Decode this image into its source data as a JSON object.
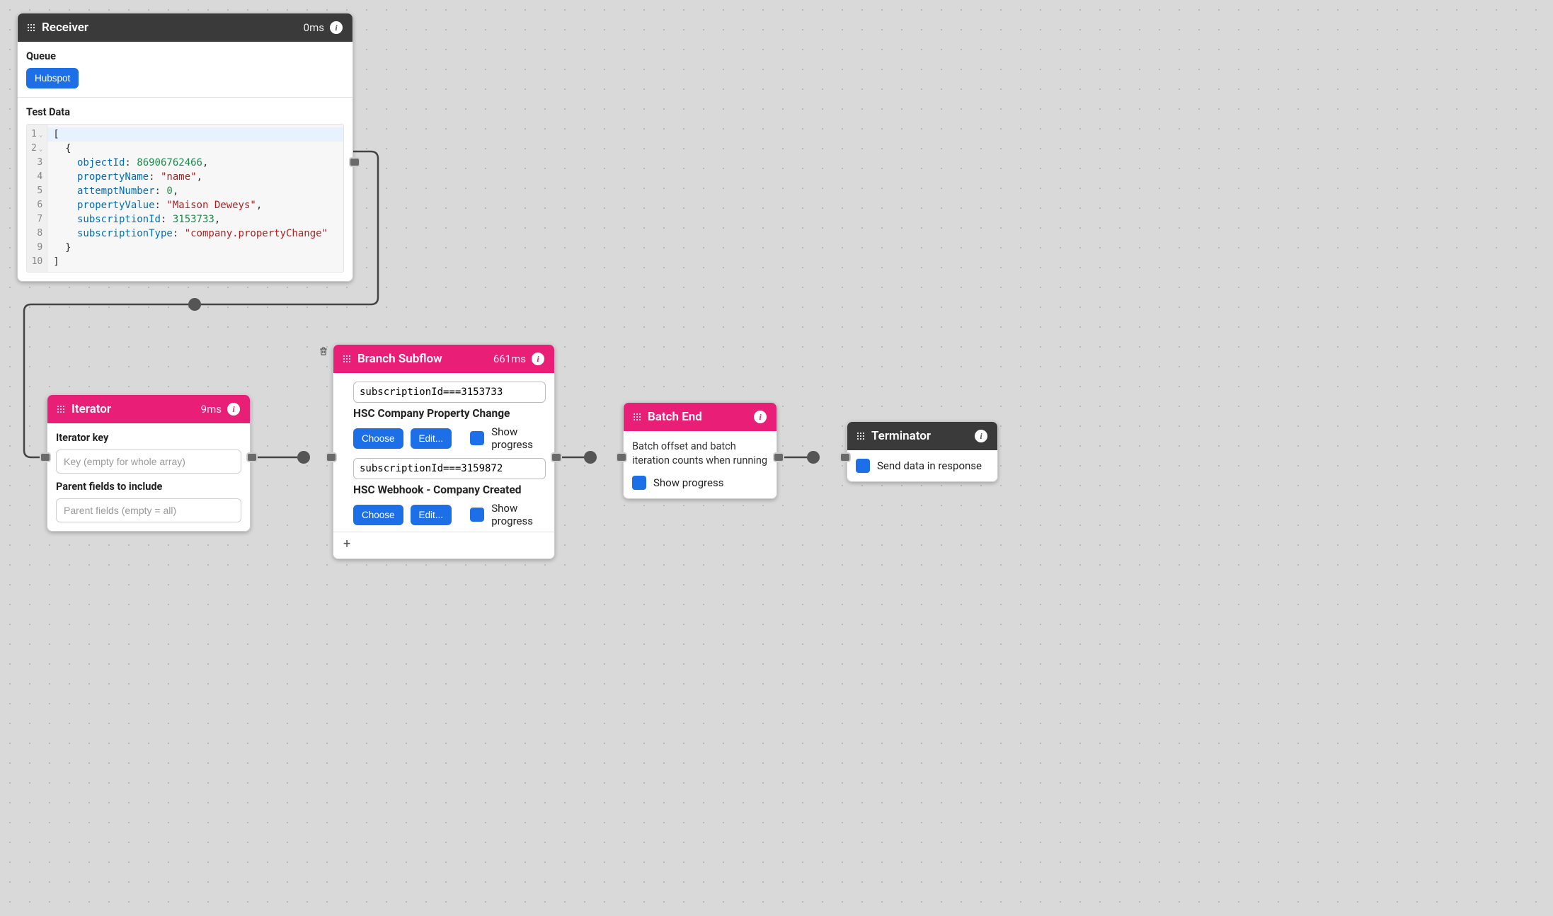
{
  "receiver": {
    "title": "Receiver",
    "time": "0ms",
    "queue_label": "Queue",
    "queue_pill": "Hubspot",
    "testdata_label": "Test Data",
    "code": {
      "lines": [
        "[",
        "  {",
        "    objectId: 86906762466,",
        "    propertyName: \"name\",",
        "    attemptNumber: 0,",
        "    propertyValue: \"Maison Deweys\",",
        "    subscriptionId: 3153733,",
        "    subscriptionType: \"company.propertyChange\"",
        "  }",
        "]"
      ],
      "gutter": [
        "1",
        "2",
        "3",
        "4",
        "5",
        "6",
        "7",
        "8",
        "9",
        "10"
      ]
    }
  },
  "iterator": {
    "title": "Iterator",
    "time": "9ms",
    "key_label": "Iterator key",
    "key_placeholder": "Key (empty for whole array)",
    "parent_label": "Parent fields to include",
    "parent_placeholder": "Parent fields (empty = all)"
  },
  "branch": {
    "title": "Branch Subflow",
    "time": "661ms",
    "items": [
      {
        "condition": "subscriptionId===3153733",
        "name": "HSC Company Property Change",
        "choose": "Choose",
        "edit": "Edit...",
        "show_progress": "Show progress"
      },
      {
        "condition": "subscriptionId===3159872",
        "name": "HSC Webhook - Company Created",
        "choose": "Choose",
        "edit": "Edit...",
        "show_progress": "Show progress"
      }
    ],
    "plus": "+"
  },
  "batch": {
    "title": "Batch End",
    "desc": "Batch offset and batch iteration counts when running",
    "show_progress": "Show progress"
  },
  "terminator": {
    "title": "Terminator",
    "send_label": "Send data in response"
  }
}
